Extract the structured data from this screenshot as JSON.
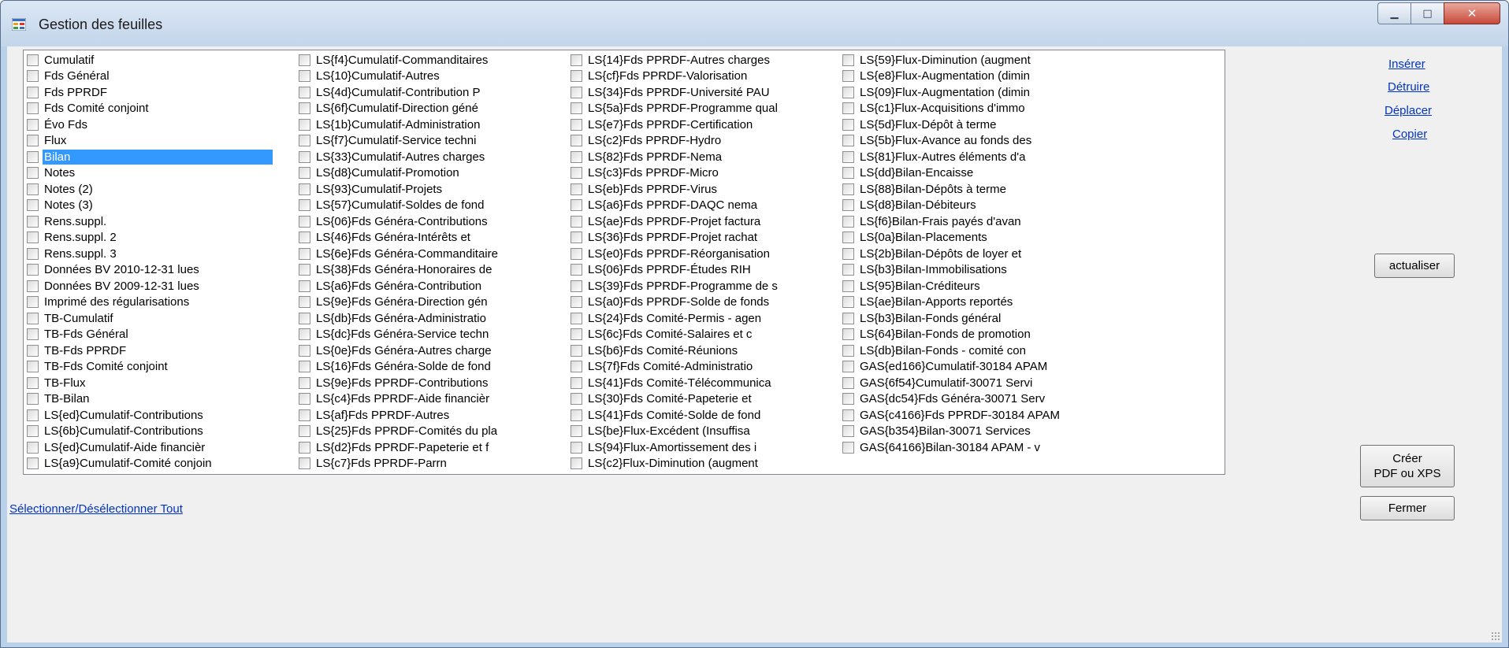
{
  "window": {
    "title": "Gestion des feuilles"
  },
  "sheets": {
    "columns": [
      [
        "Cumulatif",
        "Fds Général",
        "Fds PPRDF",
        "Fds Comité conjoint",
        "Évo Fds",
        "Flux",
        "Bilan",
        "Notes",
        "Notes (2)",
        "Notes (3)",
        "Rens.suppl.",
        "Rens.suppl. 2",
        "Rens.suppl. 3",
        "Données BV 2010-12-31 lues",
        "Données BV 2009-12-31 lues",
        "Imprimé des régularisations",
        "TB-Cumulatif",
        "TB-Fds Général",
        "TB-Fds PPRDF",
        "TB-Fds Comité conjoint",
        "TB-Flux",
        "TB-Bilan",
        "LS{ed}Cumulatif-Contributions",
        "LS{6b}Cumulatif-Contributions",
        "LS{ed}Cumulatif-Aide financièr",
        "LS{a9}Cumulatif-Comité conjoin"
      ],
      [
        "LS{f4}Cumulatif-Commanditaires",
        "LS{10}Cumulatif-Autres",
        "LS{4d}Cumulatif-Contribution P",
        "LS{6f}Cumulatif-Direction géné",
        "LS{1b}Cumulatif-Administration",
        "LS{f7}Cumulatif-Service techni",
        "LS{33}Cumulatif-Autres charges",
        "LS{d8}Cumulatif-Promotion",
        "LS{93}Cumulatif-Projets",
        "LS{57}Cumulatif-Soldes de fond",
        "LS{06}Fds Généra-Contributions",
        "LS{46}Fds Généra-Intérêts  et",
        "LS{6e}Fds Généra-Commanditaire",
        "LS{38}Fds Généra-Honoraires de",
        "LS{a6}Fds Généra-Contribution",
        "LS{9e}Fds Généra-Direction gén",
        "LS{db}Fds Généra-Administratio",
        "LS{dc}Fds Généra-Service techn",
        "LS{0e}Fds Généra-Autres charge",
        "LS{16}Fds Généra-Solde de fond",
        "LS{9e}Fds PPRDF-Contributions",
        "LS{c4}Fds PPRDF-Aide financièr",
        "LS{af}Fds PPRDF-Autres",
        "LS{25}Fds PPRDF-Comités du pla",
        "LS{d2}Fds PPRDF-Papeterie et f",
        "LS{c7}Fds PPRDF-Parrn"
      ],
      [
        "LS{14}Fds PPRDF-Autres charges",
        "LS{cf}Fds PPRDF-Valorisation",
        "LS{34}Fds PPRDF-Université PAU",
        "LS{5a}Fds PPRDF-Programme qual",
        "LS{e7}Fds PPRDF-Certification",
        "LS{c2}Fds PPRDF-Hydro",
        "LS{82}Fds PPRDF-Nema",
        "LS{c3}Fds PPRDF-Micro",
        "LS{eb}Fds PPRDF-Virus",
        "LS{a6}Fds PPRDF-DAQC nema",
        "LS{ae}Fds PPRDF-Projet factura",
        "LS{36}Fds PPRDF-Projet rachat",
        "LS{e0}Fds PPRDF-Réorganisation",
        "LS{06}Fds PPRDF-Études RIH",
        "LS{39}Fds PPRDF-Programme de s",
        "LS{a0}Fds PPRDF-Solde de fonds",
        "LS{24}Fds Comité-Permis - agen",
        "LS{6c}Fds Comité-Salaires et c",
        "LS{b6}Fds Comité-Réunions",
        "LS{7f}Fds Comité-Administratio",
        "LS{41}Fds Comité-Télécommunica",
        "LS{30}Fds Comité-Papeterie et",
        "LS{41}Fds Comité-Solde de fond",
        "LS{be}Flux-Excédent (Insuffisa",
        "LS{94}Flux-Amortissement des i",
        "LS{c2}Flux-Diminution (augment"
      ],
      [
        "LS{59}Flux-Diminution (augment",
        "LS{e8}Flux-Augmentation (dimin",
        "LS{09}Flux-Augmentation (dimin",
        "LS{c1}Flux-Acquisitions d'immo",
        "LS{5d}Flux-Dépôt à terme",
        "LS{5b}Flux-Avance au fonds des",
        "LS{81}Flux-Autres éléments d'a",
        "LS{dd}Bilan-Encaisse",
        "LS{88}Bilan-Dépôts à terme",
        "LS{d8}Bilan-Débiteurs",
        "LS{f6}Bilan-Frais payés d'avan",
        "LS{0a}Bilan-Placements",
        "LS{2b}Bilan-Dépôts de loyer et",
        "LS{b3}Bilan-Immobilisations",
        "LS{95}Bilan-Créditeurs",
        "LS{ae}Bilan-Apports reportés",
        "LS{b3}Bilan-Fonds général",
        "LS{64}Bilan-Fonds de promotion",
        "LS{db}Bilan-Fonds - comité con",
        "GAS{ed166}Cumulatif-30184 APAM",
        "GAS{6f54}Cumulatif-30071 Servi",
        "GAS{dc54}Fds Généra-30071 Serv",
        "GAS{c4166}Fds PPRDF-30184 APAM",
        "GAS{b354}Bilan-30071 Services",
        "GAS{64166}Bilan-30184 APAM - v"
      ]
    ],
    "selected": "Bilan"
  },
  "actions": {
    "insert": "Insérer",
    "delete": "Détruire",
    "move": "Déplacer",
    "copy": "Copier",
    "refresh": "actualiser",
    "create_pdf_line1": "Créer",
    "create_pdf_line2": "PDF ou XPS",
    "close": "Fermer",
    "toggle_all": "Sélectionner/Désélectionner Tout"
  },
  "icons": {
    "app": "sheets-app-icon",
    "minimize": "minimize-icon",
    "maximize": "maximize-icon",
    "close": "close-icon"
  }
}
